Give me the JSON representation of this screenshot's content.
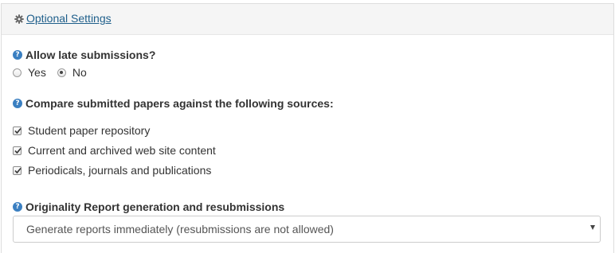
{
  "header": {
    "link_label": "Optional Settings",
    "icon": "gear-icon"
  },
  "late_submissions": {
    "label": "Allow late submissions?",
    "options": [
      {
        "label": "Yes",
        "checked": false
      },
      {
        "label": "No",
        "checked": true
      }
    ]
  },
  "sources": {
    "label": "Compare submitted papers against the following sources:",
    "items": [
      {
        "label": "Student paper repository",
        "checked": true
      },
      {
        "label": "Current and archived web site content",
        "checked": true
      },
      {
        "label": "Periodicals, journals and publications",
        "checked": true
      }
    ]
  },
  "originality": {
    "label": "Originality Report generation and resubmissions",
    "selected": "Generate reports immediately (resubmissions are not allowed)"
  },
  "colors": {
    "link": "#1f5f8b",
    "help_icon": "#3a7fc1",
    "header_bg": "#f5f5f5"
  }
}
